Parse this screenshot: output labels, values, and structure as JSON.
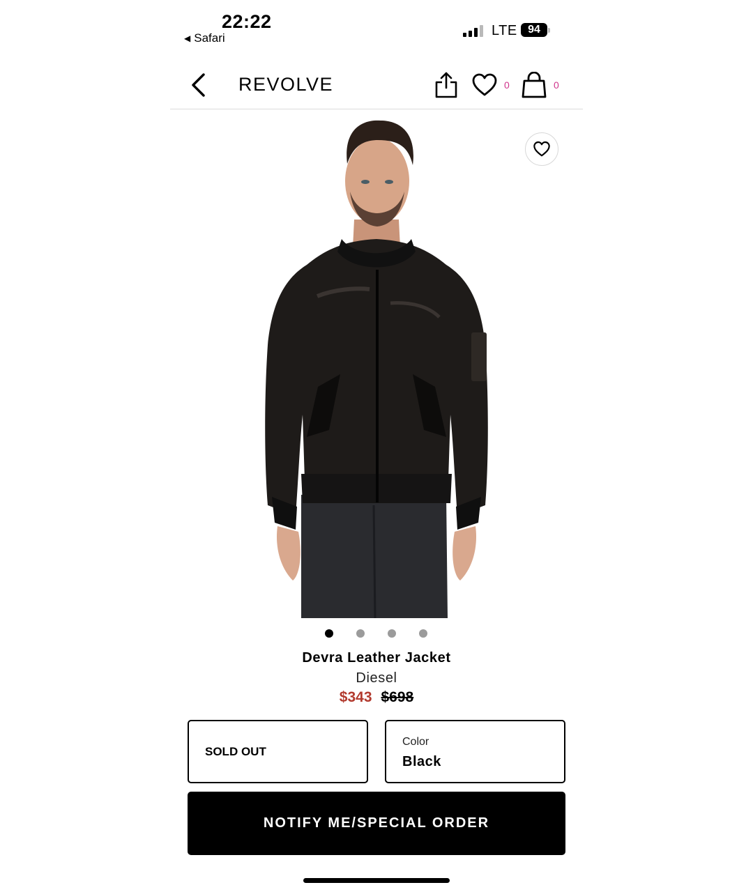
{
  "status_bar": {
    "time": "22:22",
    "back_app": "Safari",
    "network": "LTE",
    "battery": "94"
  },
  "header": {
    "logo": "REVOLVE",
    "wishlist_count": "0",
    "bag_count": "0"
  },
  "product": {
    "image_count": 4,
    "active_image": 1,
    "name": "Devra Leather Jacket",
    "brand": "Diesel",
    "sale_price": "$343",
    "original_price": "$698",
    "size_status": "SOLD OUT",
    "color_label": "Color",
    "color_value": "Black",
    "cta": "NOTIFY ME/SPECIAL ORDER"
  },
  "colors": {
    "sale_price": "#b23a2e",
    "counter": "#d0358c",
    "cta_bg": "#000000"
  }
}
